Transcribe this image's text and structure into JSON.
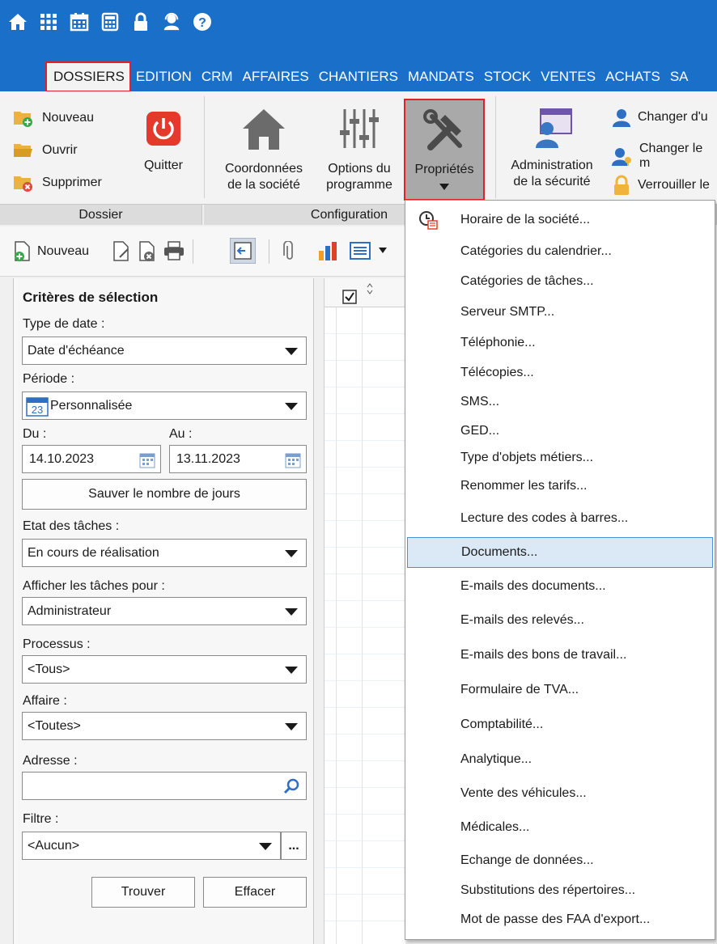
{
  "menu_tabs": [
    "DOSSIERS",
    "EDITION",
    "CRM",
    "AFFAIRES",
    "CHANTIERS",
    "MANDATS",
    "STOCK",
    "VENTES",
    "ACHATS",
    "SA"
  ],
  "ribbon": {
    "nouveau": "Nouveau",
    "ouvrir": "Ouvrir",
    "supprimer": "Supprimer",
    "quitter": "Quitter",
    "coordonnees": "Coordonnées\nde la société",
    "options": "Options du\nprogramme",
    "proprietes": "Propriétés",
    "administration": "Administration\nde la sécurité",
    "changer_u": "Changer d'u",
    "changer_le": "Changer le m",
    "verrouiller": "Verrouiller le",
    "group_dossier": "Dossier",
    "group_configuration": "Configuration"
  },
  "toolbar": {
    "nouveau": "Nouveau"
  },
  "panel": {
    "title": "Critères de sélection",
    "type_date_label": "Type de date :",
    "type_date_value": "Date d'échéance",
    "periode_label": "Période :",
    "periode_value": "Personnalisée",
    "calendar_day": "23",
    "du_label": "Du :",
    "au_label": "Au :",
    "du_value": "14.10.2023",
    "au_value": "13.11.2023",
    "sauver_button": "Sauver le nombre de jours",
    "etat_label": "Etat des tâches :",
    "etat_value": "En cours de réalisation",
    "afficher_label": "Afficher les tâches pour :",
    "afficher_value": "Administrateur",
    "processus_label": "Processus :",
    "processus_value": "<Tous>",
    "affaire_label": "Affaire :",
    "affaire_value": "<Toutes>",
    "adresse_label": "Adresse :",
    "adresse_value": "",
    "filtre_label": "Filtre :",
    "filtre_value": "<Aucun>",
    "ellipsis": "...",
    "trouver_button": "Trouver",
    "effacer_button": "Effacer"
  },
  "dropdown": {
    "items": [
      "Horaire de la société...",
      "Catégories du calendrier...",
      "Catégories de tâches...",
      "Serveur SMTP...",
      "Téléphonie...",
      "Télécopies...",
      "SMS...",
      "GED...",
      "Type d'objets métiers...",
      "Renommer les tarifs...",
      "Lecture des codes à barres...",
      "Documents...",
      "E-mails des documents...",
      "E-mails des relevés...",
      "E-mails des bons de travail...",
      "Formulaire de TVA...",
      "Comptabilité...",
      "Analytique...",
      "Vente des véhicules...",
      "Médicales...",
      "Echange de données...",
      "Substitutions des répertoires...",
      "Mot de passe des FAA d'export..."
    ],
    "hovered": "Documents..."
  },
  "colors": {
    "topbar": "#1a6fc9",
    "highlight_border": "#e0202a",
    "hover_bg": "#dbe8f5"
  }
}
